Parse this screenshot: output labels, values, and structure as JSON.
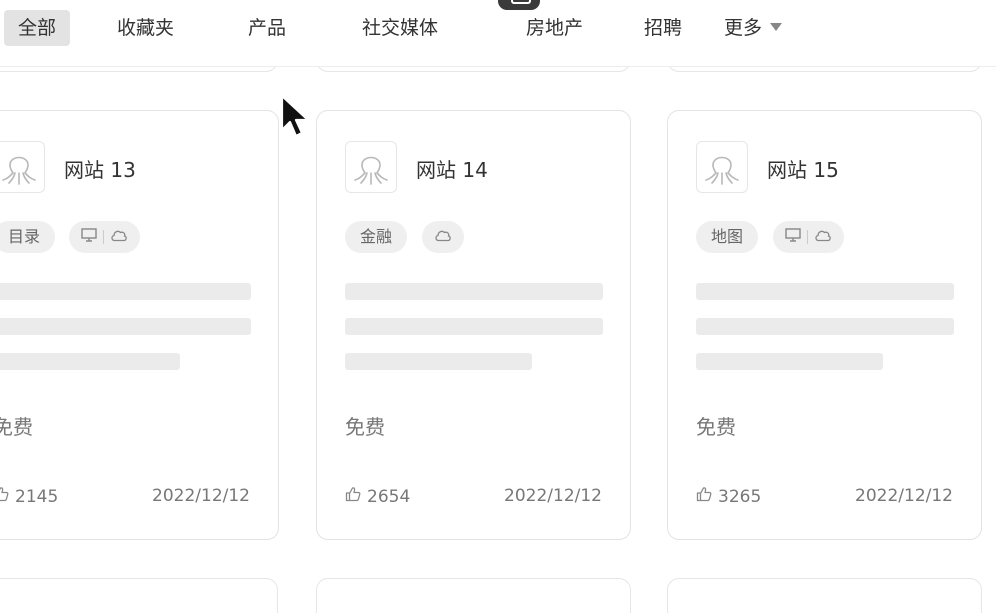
{
  "nav": {
    "tabs": [
      {
        "label": "全部",
        "active": true
      },
      {
        "label": "收藏夹"
      },
      {
        "label": "产品"
      },
      {
        "label": "社交媒体"
      },
      {
        "label": "房地产"
      },
      {
        "label": "招聘"
      },
      {
        "label": "更多"
      }
    ]
  },
  "cards": [
    {
      "title": "网站 13",
      "category": "目录",
      "platforms": [
        "monitor-icon",
        "cloud-icon"
      ],
      "price": "免费",
      "likes": "2145",
      "date": "2022/12/12"
    },
    {
      "title": "网站 14",
      "category": "金融",
      "platforms": [
        "cloud-icon"
      ],
      "price": "免费",
      "likes": "2654",
      "date": "2022/12/12"
    },
    {
      "title": "网站 15",
      "category": "地图",
      "platforms": [
        "monitor-icon",
        "cloud-icon"
      ],
      "price": "免费",
      "likes": "3265",
      "date": "2022/12/12"
    }
  ],
  "colors": {
    "card_border": "#e3e3e3",
    "active_tab_bg": "#e3e3e3",
    "skeleton": "#ebebeb"
  }
}
